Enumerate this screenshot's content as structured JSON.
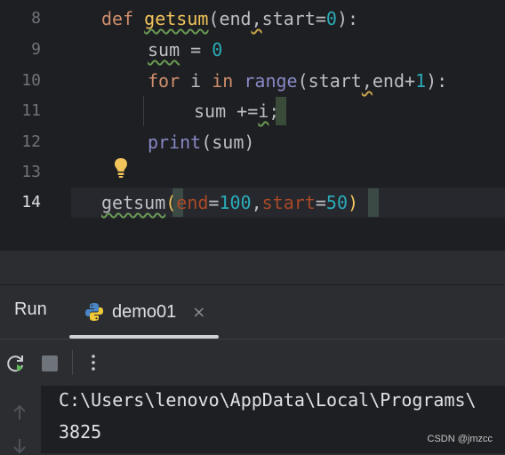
{
  "editor": {
    "line_numbers": [
      "8",
      "9",
      "10",
      "11",
      "12",
      "13",
      "14"
    ],
    "lines": {
      "l8": {
        "def": "def",
        "name": "getsum",
        "open": "(",
        "p1": "end",
        "comma": ",",
        "p2": "start",
        "eq": "=",
        "zero": "0",
        "close": "):"
      },
      "l9": {
        "sum": "sum",
        "eq": " = ",
        "zero": "0"
      },
      "l10": {
        "for": "for",
        "i": " i ",
        "in": "in",
        "range": " range",
        "args1": "(start",
        "comma": ",",
        "args2": "end+",
        "one": "1",
        "close": "):"
      },
      "l11": {
        "text": "sum +=",
        "i": "i",
        ";": ";"
      },
      "l12": {
        "print": "print",
        "args": "(sum)"
      },
      "l14": {
        "name": "getsum",
        "open": "(",
        "k1": "end",
        "eq1": "=",
        "v1": "100",
        "comma": ",",
        "k2": "start",
        "eq2": "=",
        "v2": "50",
        "close": ")"
      }
    }
  },
  "run": {
    "title": "Run",
    "tab": {
      "name": "demo01",
      "close": "×"
    }
  },
  "console": {
    "line1": "C:\\Users\\lenovo\\AppData\\Local\\Programs\\",
    "line2": "3825"
  },
  "watermark": "CSDN @jmzcc",
  "icons": [
    "lightbulb-icon",
    "python-icon",
    "rerun-icon",
    "stop-icon",
    "more-vert-icon",
    "arrow-up-icon",
    "arrow-down-icon"
  ]
}
